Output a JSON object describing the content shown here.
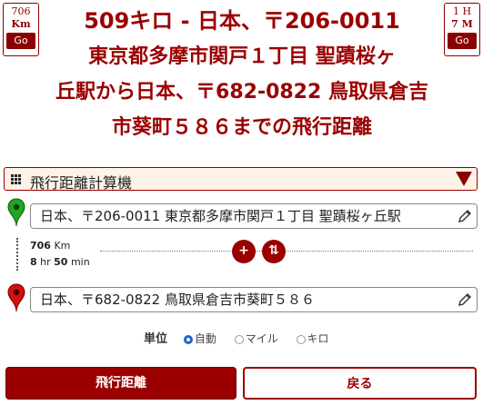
{
  "badges": {
    "left": {
      "line1": "706",
      "line2": "Km",
      "go": "Go"
    },
    "right": {
      "line1": "1 H",
      "line2": "7 M",
      "go": "Go"
    }
  },
  "title": {
    "line1": "509キロ - 日本、〒206-0011",
    "line2": "東京都多摩市関戸１丁目 聖蹟桜ヶ",
    "line3": "丘駅から日本、〒682-0822 鳥取県倉吉",
    "line4": "市葵町５８６までの飛行距離"
  },
  "selector": {
    "value": "飛行距離計算機"
  },
  "origin": {
    "value": "日本、〒206-0011 東京都多摩市関戸１丁目 聖蹟桜ヶ丘駅"
  },
  "destination": {
    "value": "日本、〒682-0822 鳥取県倉吉市葵町５８６"
  },
  "route": {
    "distance_value": "706",
    "distance_unit": "Km",
    "hours_value": "8",
    "hours_unit": "hr",
    "minutes_value": "50",
    "minutes_unit": "min",
    "add_label": "+",
    "swap_label": "⇅"
  },
  "units": {
    "label": "単位",
    "options": [
      "自動",
      "マイル",
      "キロ"
    ],
    "selected": "自動"
  },
  "buttons": {
    "primary": "飛行距離",
    "secondary": "戻る"
  },
  "colors": {
    "accent": "#9b0000",
    "radio_selected": "#1a66cc",
    "origin_pin": "#1fa61f",
    "destination_pin": "#d01010"
  }
}
